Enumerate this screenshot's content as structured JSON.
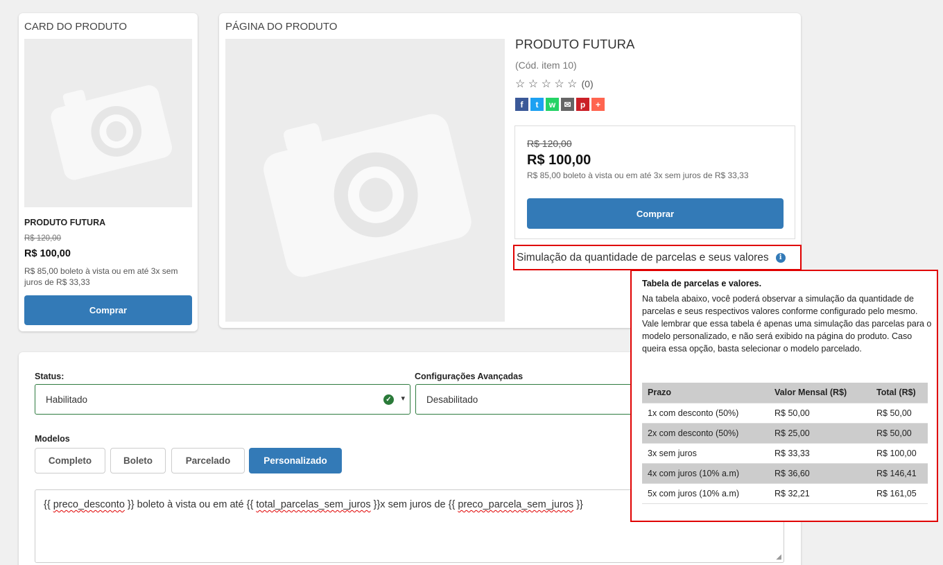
{
  "card": {
    "heading": "CARD DO PRODUTO",
    "product_name": "PRODUTO FUTURA",
    "old_price": "R$ 120,00",
    "price": "R$ 100,00",
    "installments": "R$ 85,00 boleto à vista ou em até 3x sem juros de R$ 33,33",
    "buy_label": "Comprar"
  },
  "page": {
    "heading": "PÁGINA DO PRODUTO",
    "product_title": "PRODUTO FUTURA",
    "code": "(Cód. item 10)",
    "stars": "☆ ☆ ☆ ☆ ☆",
    "rating_count": "(0)",
    "share": [
      {
        "name": "facebook",
        "glyph": "f",
        "color": "#3b5998"
      },
      {
        "name": "twitter",
        "glyph": "t",
        "color": "#1da1f2"
      },
      {
        "name": "whatsapp",
        "glyph": "w",
        "color": "#25d366"
      },
      {
        "name": "email",
        "glyph": "✉",
        "color": "#666666"
      },
      {
        "name": "pinterest",
        "glyph": "p",
        "color": "#cb2027"
      },
      {
        "name": "more",
        "glyph": "+",
        "color": "#ff6550"
      }
    ],
    "old_price": "R$ 120,00",
    "price": "R$ 100,00",
    "installments": "R$ 85,00 boleto à vista ou em até 3x sem juros de R$ 33,33",
    "buy_label": "Comprar",
    "simulation_label": "Simulação da quantidade de parcelas e seus valores",
    "info_icon": "i"
  },
  "config": {
    "status_label": "Status:",
    "status_value": "Habilitado",
    "advanced_label": "Configurações Avançadas",
    "advanced_value": "Desabilitado",
    "models_label": "Modelos",
    "models": [
      "Completo",
      "Boleto",
      "Parcelado",
      "Personalizado"
    ],
    "active_model": "Personalizado",
    "template_parts": [
      {
        "text": "{{ ",
        "spell": false
      },
      {
        "text": "preco_desconto",
        "spell": true
      },
      {
        "text": " }} boleto à vista ou em até {{ ",
        "spell": false
      },
      {
        "text": "total_parcelas_sem_juros",
        "spell": true
      },
      {
        "text": " }}x sem juros de {{ ",
        "spell": false
      },
      {
        "text": "preco_parcela_sem_juros",
        "spell": true
      },
      {
        "text": " }}",
        "spell": false
      }
    ]
  },
  "popover": {
    "title": "Tabela de parcelas e valores.",
    "description": "Na tabela abaixo, você poderá observar a simulação da quantidade de parcelas e seus respectivos valores conforme configurado pelo mesmo. Vale lembrar que essa tabela é apenas uma simulação das parcelas para o modelo personalizado, e não será exibido na página do produto. Caso queira essa opção, basta selecionar o modelo parcelado.",
    "headers": [
      "Prazo",
      "Valor Mensal (R$)",
      "Total (R$)"
    ],
    "rows": [
      [
        "1x com desconto (50%)",
        "R$ 50,00",
        "R$ 50,00"
      ],
      [
        "2x com desconto (50%)",
        "R$ 25,00",
        "R$ 50,00"
      ],
      [
        "3x sem juros",
        "R$ 33,33",
        "R$ 100,00"
      ],
      [
        "4x com juros (10% a.m)",
        "R$ 36,60",
        "R$ 146,41"
      ],
      [
        "5x com juros (10% a.m)",
        "R$ 32,21",
        "R$ 161,05"
      ]
    ]
  },
  "colors": {
    "primary": "#337ab7",
    "highlight_border": "#e00000",
    "valid_border": "#2d7a3e"
  }
}
